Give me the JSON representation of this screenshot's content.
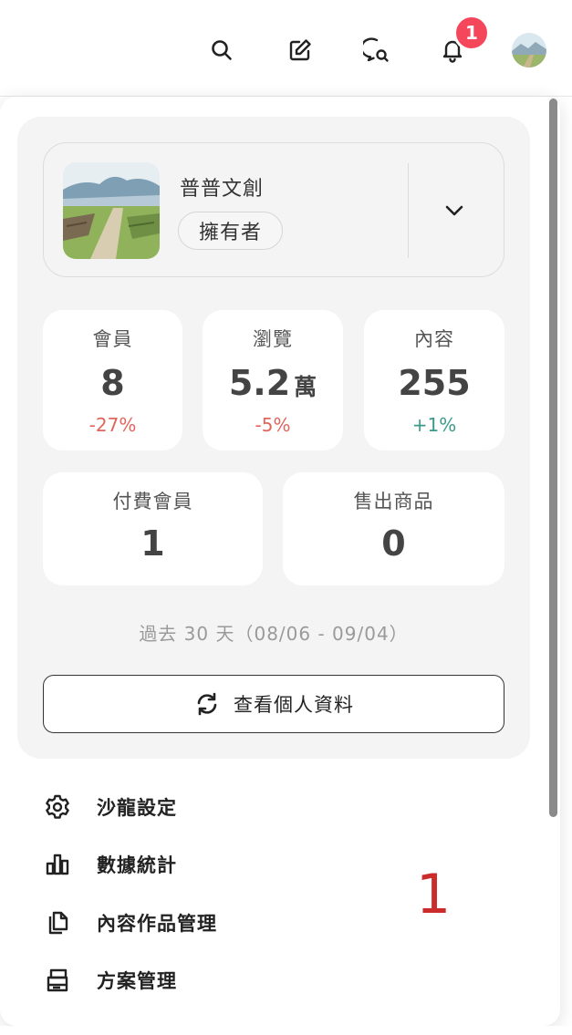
{
  "topbar": {
    "icons": [
      "search-icon",
      "edit-icon",
      "chat-search-icon",
      "bell-icon"
    ],
    "notification_count": "1"
  },
  "account": {
    "name": "普普文創",
    "role": "擁有者"
  },
  "stats": {
    "members": {
      "label": "會員",
      "value": "8",
      "delta": "-27%"
    },
    "views": {
      "label": "瀏覽",
      "value": "5.2",
      "unit": "萬",
      "delta": "-5%"
    },
    "content": {
      "label": "內容",
      "value": "255",
      "delta": "+1%"
    },
    "paid_members": {
      "label": "付費會員",
      "value": "1"
    },
    "products_sold": {
      "label": "售出商品",
      "value": "0"
    }
  },
  "period": "過去 30 天（08/06 - 09/04）",
  "profile_button": "查看個人資料",
  "menu": {
    "items": [
      {
        "label": "沙龍設定",
        "icon": "gear-icon"
      },
      {
        "label": "數據統計",
        "icon": "bar-chart-icon"
      },
      {
        "label": "內容作品管理",
        "icon": "documents-icon"
      },
      {
        "label": "方案管理",
        "icon": "plan-icon"
      }
    ]
  },
  "annotation": "1",
  "colors": {
    "badge": "#f5475c",
    "negative": "#e0655c",
    "positive": "#3a9a8a",
    "annotation": "#cc2b2b"
  }
}
